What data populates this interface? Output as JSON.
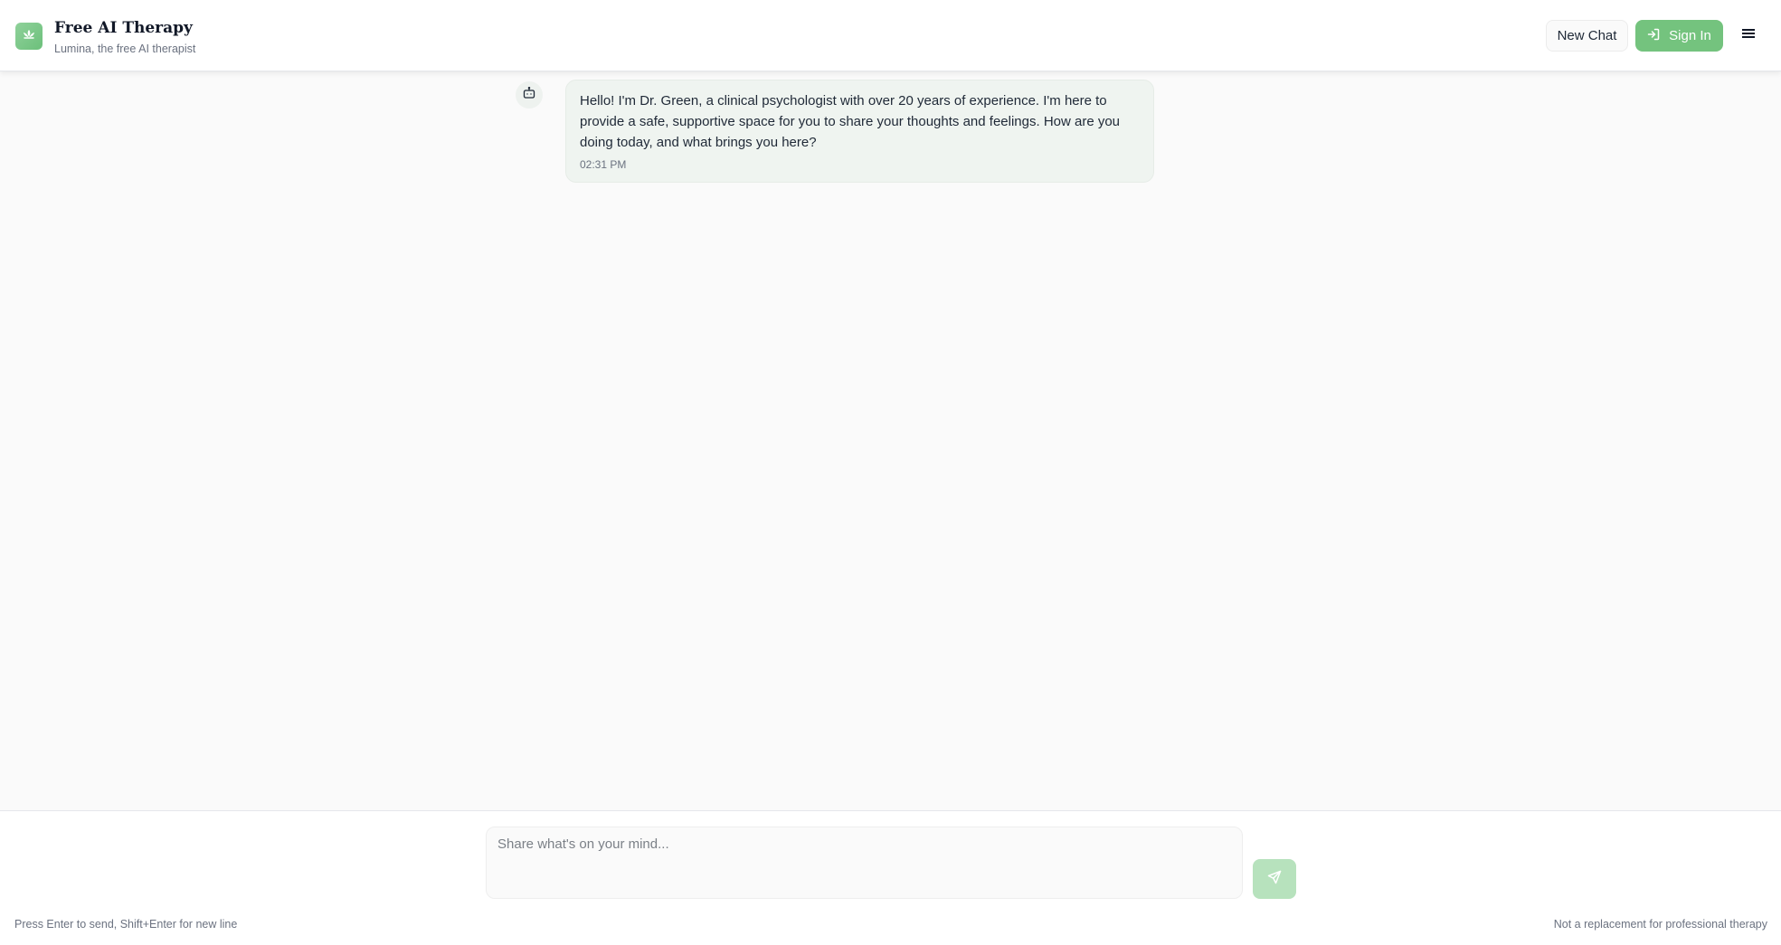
{
  "header": {
    "title": "Free AI Therapy",
    "subtitle": "Lumina, the free AI therapist",
    "logo_icon": "lotus-icon",
    "new_chat_label": "New Chat",
    "sign_in_label": "Sign In",
    "sign_in_icon": "login-icon",
    "menu_icon": "hamburger-menu-icon"
  },
  "chat": {
    "messages": [
      {
        "sender": "bot",
        "avatar_icon": "bot-icon",
        "text": "Hello! I'm Dr. Green, a clinical psychologist with over 20 years of experience. I'm here to provide a safe, supportive space for you to share your thoughts and feelings. How are you doing today, and what brings you here?",
        "time": "02:31 PM"
      }
    ]
  },
  "composer": {
    "placeholder": "Share what's on your mind...",
    "value": "",
    "send_icon": "send-icon",
    "hint_left": "Press Enter to send, Shift+Enter for new line",
    "hint_right": "Not a replacement for professional therapy"
  },
  "colors": {
    "accent": "#74c37e",
    "accent_light": "#b7e2bd",
    "bubble_bg": "#eff4f0",
    "page_bg": "#fafafa"
  }
}
